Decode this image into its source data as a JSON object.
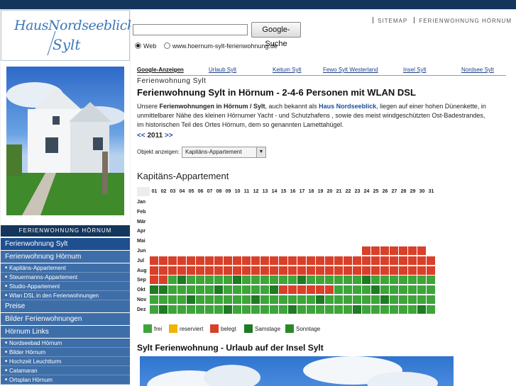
{
  "header": {
    "logo_line1": "HausNordseeblick",
    "logo_line2": "Sylt",
    "top_links": [
      "SITEMAP",
      "FERIENWOHNUNG HÖRNUM"
    ]
  },
  "search": {
    "button_label": "Google-Suche",
    "query": "",
    "radio_web": "Web",
    "radio_site": "www.hoernum-sylt-ferienwohnung.de"
  },
  "sidebar": {
    "header": "FERIENWOHNUNG HÖRNUM",
    "items": [
      {
        "label": "Ferienwohnung Sylt",
        "level": "main",
        "active": true
      },
      {
        "label": "Ferienwohnung Hörnum",
        "level": "main"
      },
      {
        "label": "Kapitäns-Appartement",
        "level": "sub"
      },
      {
        "label": "Steuermanns-Appartement",
        "level": "sub"
      },
      {
        "label": "Studio-Appartement",
        "level": "sub"
      },
      {
        "label": "Wlan DSL in den Ferienwohnungen",
        "level": "sub"
      },
      {
        "label": "Preise",
        "level": "main"
      },
      {
        "label": "Bilder Ferienwohnungen",
        "level": "main"
      },
      {
        "label": "Hörnum Links",
        "level": "main"
      },
      {
        "label": "Nordseebad Hörnum",
        "level": "sub"
      },
      {
        "label": "Bilder Hörnum",
        "level": "sub"
      },
      {
        "label": "Hochzeit Leuchtturm",
        "level": "sub"
      },
      {
        "label": "Catamaran",
        "level": "sub"
      },
      {
        "label": "Ortsplan Hörnum",
        "level": "sub"
      }
    ]
  },
  "tabs": [
    "Google-Anzeigen",
    "Urlaub Sylt",
    "Keitum Sylt",
    "Fewo Sylt Westerland",
    "Insel Sylt",
    "Nordsee Sylt"
  ],
  "breadcrumb": "Ferienwohnung Sylt",
  "main": {
    "title": "Ferienwohnung Sylt in Hörnum - 2-4-6  Personen mit WLAN DSL",
    "intro_1": "Unsere ",
    "intro_bold1": "Ferienwohnungen in  Hörnum / Sylt",
    "intro_2": ", auch bekannt als ",
    "intro_bold2": "Haus Nordseeblick",
    "intro_3": ", liegen auf einer hohen Dünenkette,  in unmittelbarer Nähe des kleinen Hörnumer Yacht - und Schutzhafens , sowie des meist windgeschützten Ost-Badestrandes, im historischen Teil des Ortes Hörnum, dem so genannten Lamettahügel.",
    "year_prev": "<<",
    "year": "2011",
    "year_next": ">>",
    "object_label": "Objekt anzeigen:",
    "object_selected": "Kapitäns-Appartement",
    "calendar_title": "Kapitäns-Appartement",
    "section_title": "Sylt Ferienwohnung  - Urlaub auf der Insel Sylt"
  },
  "legend": [
    {
      "label": "frei",
      "color": "#3ea53a"
    },
    {
      "label": "reserviert",
      "color": "#f0b400"
    },
    {
      "label": "belegt",
      "color": "#d8402a"
    },
    {
      "label": "Samstage",
      "color": "#1f7b24"
    },
    {
      "label": "Sonntage",
      "color": "#2a8a26"
    }
  ],
  "calendar": {
    "days": [
      "01",
      "02",
      "03",
      "04",
      "05",
      "06",
      "07",
      "08",
      "09",
      "10",
      "11",
      "12",
      "13",
      "14",
      "15",
      "16",
      "17",
      "18",
      "19",
      "20",
      "21",
      "22",
      "23",
      "24",
      "25",
      "26",
      "27",
      "28",
      "29",
      "30",
      "31"
    ],
    "months": [
      "Jan",
      "Feb",
      "Mär",
      "Apr",
      "Mai",
      "Jun",
      "Jul",
      "Aug",
      "Sep",
      "Okt",
      "Nov",
      "Dez"
    ],
    "colors": {
      "f": "#3ea53a",
      "b": "#d8402a",
      "s": "#1f7b24",
      "u": "#2a8a26"
    },
    "rows": [
      "",
      "",
      "",
      "",
      "",
      "_______________________bbbbbbb_",
      "bbbbbbbbbbbbbbbbbbbbbbbbbbbbbbb",
      "bbbbbbbbbbbbbbbbbbbbbbbbbbbbbbb",
      "bbfsfffffsffffffsffffffsfffffff",
      "ssfffffsfffffsbbbbbbffffsffffff",
      "ffffsffffffsffffffsffffffsfffff",
      "fsffffffsffffffsffffffsffffffsf"
    ]
  }
}
